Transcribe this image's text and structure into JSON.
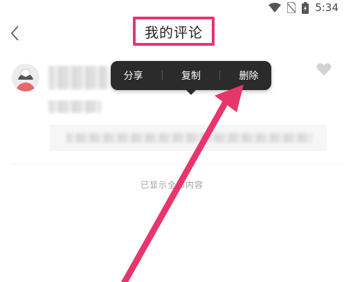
{
  "status_bar": {
    "time": "5:34",
    "icons": [
      "wifi-icon",
      "no-sim-icon",
      "battery-icon"
    ]
  },
  "header": {
    "title": "我的评论",
    "back_icon": "chevron-left-icon",
    "highlight_color": "#e8356b"
  },
  "popup_menu": {
    "items": [
      "分享",
      "复制",
      "删除"
    ]
  },
  "list_footer": {
    "text": "已显示全部内容"
  },
  "annotation": {
    "arrow_color": "#e8356b"
  }
}
